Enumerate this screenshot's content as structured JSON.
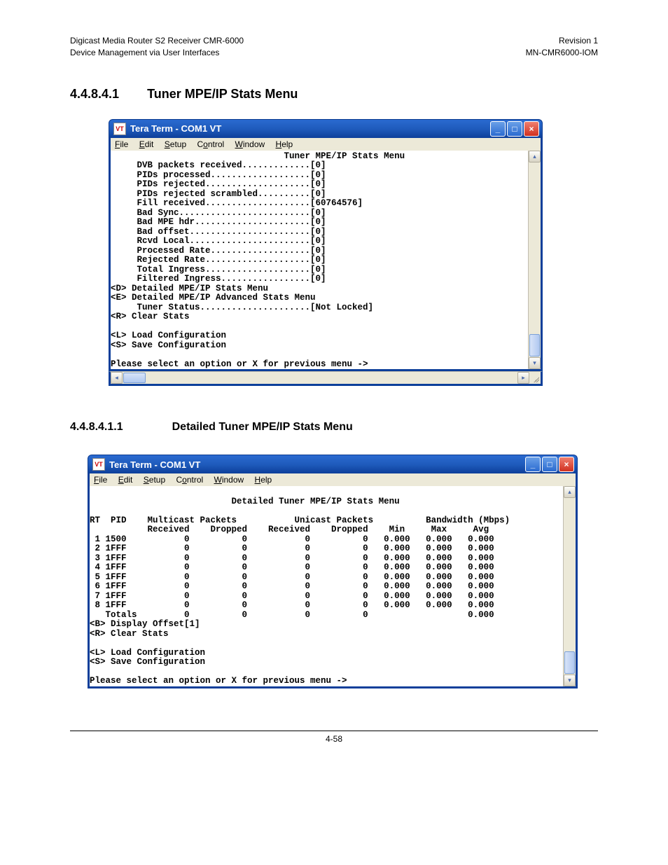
{
  "header": {
    "left_line1": "Digicast Media Router S2 Receiver CMR-6000",
    "left_line2": "Device Management via User Interfaces",
    "right_line1": "Revision 1",
    "right_line2": "MN-CMR6000-IOM"
  },
  "section1": {
    "num": "4.4.8.4.1",
    "title": "Tuner MPE/IP Stats Menu"
  },
  "section2": {
    "num": "4.4.8.4.1.1",
    "title": "Detailed Tuner MPE/IP Stats Menu"
  },
  "page_number": "4-58",
  "window1": {
    "title": "Tera Term - COM1 VT",
    "menus": {
      "file": "File",
      "edit": "Edit",
      "setup": "Setup",
      "control": "Control",
      "window": "Window",
      "help": "Help"
    },
    "terminal": {
      "heading": "Tuner MPE/IP Stats Menu",
      "stats": [
        {
          "label": "DVB packets received",
          "value": "0"
        },
        {
          "label": "PIDs processed",
          "value": "0"
        },
        {
          "label": "PIDs rejected",
          "value": "0"
        },
        {
          "label": "PIDs rejected scrambled",
          "value": "0"
        },
        {
          "label": "Fill received",
          "value": "60764576"
        },
        {
          "label": "Bad Sync",
          "value": "0"
        },
        {
          "label": "Bad MPE hdr",
          "value": "0"
        },
        {
          "label": "Bad offset",
          "value": "0"
        },
        {
          "label": "Rcvd Local",
          "value": "0"
        },
        {
          "label": "Processed Rate",
          "value": "0"
        },
        {
          "label": "Rejected Rate",
          "value": "0"
        },
        {
          "label": "Total Ingress",
          "value": "0"
        },
        {
          "label": "Filtered Ingress",
          "value": "0"
        }
      ],
      "opt_d": "<D> Detailed MPE/IP Stats Menu",
      "opt_e": "<E> Detailed MPE/IP Advanced Stats Menu",
      "tuner_status_label": "Tuner Status",
      "tuner_status_value": "Not Locked",
      "opt_r": "<R> Clear Stats",
      "opt_l": "<L> Load Configuration",
      "opt_s": "<S> Save Configuration",
      "prompt": "Please select an option or X for previous menu ->"
    }
  },
  "window2": {
    "title": "Tera Term - COM1 VT",
    "menus": {
      "file": "File",
      "edit": "Edit",
      "setup": "Setup",
      "control": "Control",
      "window": "Window",
      "help": "Help"
    },
    "terminal": {
      "heading": "Detailed Tuner MPE/IP Stats Menu",
      "header_groups": {
        "multicast": "Multicast Packets",
        "unicast": "Unicast Packets",
        "bandwidth": "Bandwidth (Mbps)"
      },
      "columns": {
        "rt": "RT",
        "pid": "PID",
        "received": "Received",
        "dropped": "Dropped",
        "received2": "Received",
        "dropped2": "Dropped",
        "min": "Min",
        "max": "Max",
        "avg": "Avg"
      },
      "rows": [
        {
          "rt": "1",
          "pid": "1500",
          "mrec": "0",
          "mdrop": "0",
          "urec": "0",
          "udrop": "0",
          "min": "0.000",
          "max": "0.000",
          "avg": "0.000"
        },
        {
          "rt": "2",
          "pid": "1FFF",
          "mrec": "0",
          "mdrop": "0",
          "urec": "0",
          "udrop": "0",
          "min": "0.000",
          "max": "0.000",
          "avg": "0.000"
        },
        {
          "rt": "3",
          "pid": "1FFF",
          "mrec": "0",
          "mdrop": "0",
          "urec": "0",
          "udrop": "0",
          "min": "0.000",
          "max": "0.000",
          "avg": "0.000"
        },
        {
          "rt": "4",
          "pid": "1FFF",
          "mrec": "0",
          "mdrop": "0",
          "urec": "0",
          "udrop": "0",
          "min": "0.000",
          "max": "0.000",
          "avg": "0.000"
        },
        {
          "rt": "5",
          "pid": "1FFF",
          "mrec": "0",
          "mdrop": "0",
          "urec": "0",
          "udrop": "0",
          "min": "0.000",
          "max": "0.000",
          "avg": "0.000"
        },
        {
          "rt": "6",
          "pid": "1FFF",
          "mrec": "0",
          "mdrop": "0",
          "urec": "0",
          "udrop": "0",
          "min": "0.000",
          "max": "0.000",
          "avg": "0.000"
        },
        {
          "rt": "7",
          "pid": "1FFF",
          "mrec": "0",
          "mdrop": "0",
          "urec": "0",
          "udrop": "0",
          "min": "0.000",
          "max": "0.000",
          "avg": "0.000"
        },
        {
          "rt": "8",
          "pid": "1FFF",
          "mrec": "0",
          "mdrop": "0",
          "urec": "0",
          "udrop": "0",
          "min": "0.000",
          "max": "0.000",
          "avg": "0.000"
        }
      ],
      "totals": {
        "label": "Totals",
        "mrec": "0",
        "mdrop": "0",
        "urec": "0",
        "udrop": "0",
        "avg": "0.000"
      },
      "opt_b": "<B> Display Offset[1]",
      "opt_r": "<R> Clear Stats",
      "opt_l": "<L> Load Configuration",
      "opt_s": "<S> Save Configuration",
      "prompt": "Please select an option or X for previous menu ->"
    }
  }
}
